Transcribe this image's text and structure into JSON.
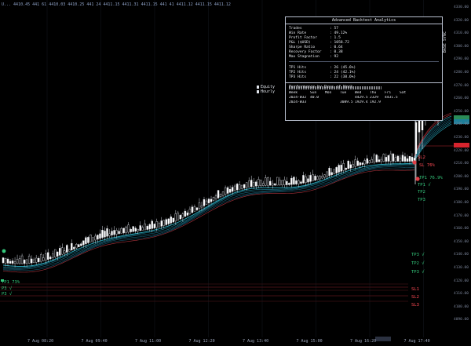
{
  "ticker": {
    "items": [
      "U...",
      "4410.45",
      "441",
      "61",
      "4410.03",
      "4410.25",
      "441",
      "24",
      "4411.15",
      "4411.31",
      "4411.15",
      "441",
      "41",
      "4411.12",
      "4411.15",
      "4411.12"
    ]
  },
  "analytics_panel": {
    "title": "Advanced Backtest Analytics",
    "stats": [
      {
        "label": "Trades",
        "value": ": 57"
      },
      {
        "label": "Win Rate",
        "value": ": 49.12%"
      },
      {
        "label": "Profit Factor",
        "value": ": 1.5"
      },
      {
        "label": "P&L ($USD)",
        "value": ": 1058.72"
      },
      {
        "label": "Sharpe Ratio",
        "value": ": 0.64"
      },
      {
        "label": "Recovery Factor",
        "value": ": 0.38"
      },
      {
        "label": "Max Stagnation",
        "value": ": 92"
      }
    ],
    "tp_hits": [
      {
        "label": "TP1 Hits",
        "value": ": 26 (45.6%)"
      },
      {
        "label": "TP2 Hits",
        "value": ": 24 (42.1%)"
      },
      {
        "label": "TP3 Hits",
        "value": ": 22 (38.6%)"
      }
    ],
    "perf_title": "Performance by Days of Week",
    "perf_headers": [
      "Week",
      "Sun",
      "Mon",
      "Tue",
      "Wed",
      "Thu",
      "Fri",
      "Sat"
    ],
    "perf_rows": [
      [
        "2024-W32",
        "40.0",
        "",
        "",
        "4429.5",
        "2329",
        "4431.5",
        ""
      ],
      [
        "2024-W33",
        "",
        "",
        "3089.5",
        "1929.4",
        "192.9",
        "",
        ""
      ]
    ]
  },
  "legend": {
    "equity": "Equity",
    "hourly": "Hourly"
  },
  "side_label": "BASE SYNC",
  "y_axis": {
    "labels": [
      "4330.00",
      "4320.00",
      "4310.00",
      "4300.00",
      "4290.00",
      "4280.00",
      "4270.00",
      "4260.00",
      "4250.00",
      "4240.00",
      "4230.00",
      "4220.00",
      "4210.00",
      "4200.00",
      "4190.00",
      "4180.00",
      "4170.00",
      "4160.00",
      "4150.00",
      "4140.00",
      "4130.00",
      "4120.00",
      "4110.00",
      "4100.00",
      "4090.00"
    ]
  },
  "x_axis": {
    "labels": [
      "7 Aug 08:20",
      "7 Aug 09:40",
      "7 Aug 11:00",
      "7 Aug 12:20",
      "7 Aug 13:40",
      "7 Aug 15:00",
      "7 Aug 16:20",
      "7 Aug 17:40"
    ]
  },
  "right_tags": {
    "tp_green": [
      "TP3",
      "TP1",
      "TP3 √",
      "TP2 √",
      "TP3 √"
    ],
    "tp_upper": [
      "TP1 √",
      "TP2",
      "TP3"
    ],
    "sl_red": [
      "SL1",
      "SL2",
      "SL3"
    ],
    "sl_upper": "SL2",
    "upper_pct": "TP1 76.9%",
    "upper_red_pct": "SL 76%"
  },
  "left_tags": {
    "top": "TP1 73%",
    "mid": "P3 √",
    "bot": "P3 √"
  },
  "colors": {
    "bg": "#000000",
    "bull": "#ffffff",
    "ema": "#2bb3c8",
    "ema_dark": "#1e6f86",
    "sl": "#e04048",
    "tp": "#34c77b"
  }
}
